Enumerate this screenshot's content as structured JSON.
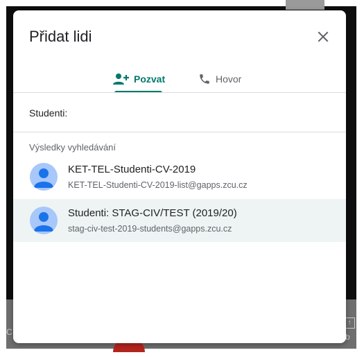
{
  "dialog": {
    "title": "Přidat lidi",
    "close_icon": "close-icon",
    "tabs": [
      {
        "label": "Pozvat",
        "icon": "person-add-icon",
        "active": true
      },
      {
        "label": "Hovor",
        "icon": "phone-icon",
        "active": false
      }
    ],
    "search": {
      "value": "Studenti:"
    },
    "results_label": "Výsledky vyhledávání",
    "results": [
      {
        "name": "KET-TEL-Studenti-CV-2019",
        "email": "KET-TEL-Studenti-CV-2019-list@gapps.zcu.cz",
        "highlighted": false
      },
      {
        "name": "Studenti: STAG-CIV/TEST (2019/20)",
        "email": "stag-civ-test-2019-students@gapps.zcu.cz",
        "highlighted": true
      }
    ]
  },
  "background": {
    "letter_left": "C",
    "letter_right": "b",
    "upload_glyph": "↑"
  },
  "colors": {
    "accent": "#00796b",
    "avatar_bg": "#a8c7fa",
    "avatar_fg": "#1a73e8",
    "highlight_row": "#eef4f4",
    "divider": "#dadce0"
  }
}
